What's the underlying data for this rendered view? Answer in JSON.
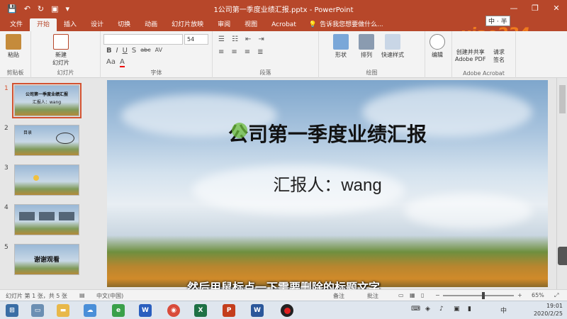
{
  "window": {
    "title": "1公司第一季度业绩汇报.pptx - PowerPoint",
    "controls": [
      "—",
      "❐",
      "✕"
    ]
  },
  "tabs": [
    {
      "label": "文件"
    },
    {
      "label": "开始"
    },
    {
      "label": "插入"
    },
    {
      "label": "设计"
    },
    {
      "label": "切换"
    },
    {
      "label": "动画"
    },
    {
      "label": "幻灯片放映"
    },
    {
      "label": "审阅"
    },
    {
      "label": "视图"
    },
    {
      "label": "Acrobat"
    }
  ],
  "tell_me": "告诉我您想要做什么...",
  "ribbon": {
    "paste": "粘贴",
    "clipboard": "剪贴板",
    "new_slide": "新建\n幻灯片",
    "slides_group": "幻灯片",
    "font_size": "54",
    "font_group": "字体",
    "paragraph_group": "段落",
    "shape": "形状",
    "arrange": "排列",
    "quick_styles": "快速样式",
    "drawing_group": "绘图",
    "edit": "编辑",
    "create_share": "创建并共享\nAdobe PDF",
    "request_sign": "请求\n签名",
    "adobe_group": "Adobe Acrobat",
    "font_buttons": [
      "B",
      "I",
      "U",
      "S",
      "abc",
      "AV",
      "Aa",
      "A"
    ]
  },
  "thumbnails": [
    {
      "num": "1",
      "text": "公司第一季度业绩汇报",
      "sub": "汇报人：wang"
    },
    {
      "num": "2",
      "text": "目录",
      "sub": ""
    },
    {
      "num": "3",
      "text": "",
      "sub": ""
    },
    {
      "num": "4",
      "text": "",
      "sub": ""
    },
    {
      "num": "5",
      "text": "谢谢观看",
      "sub": ""
    }
  ],
  "slide": {
    "title": "公司第一季度业绩汇报",
    "reporter_label": "汇报人：",
    "reporter_name": "wang"
  },
  "caption": "然后用鼠标点一下需要删除的标题文字",
  "status": {
    "slide_info": "幻灯片 第 1 张，共 5 张",
    "language": "中文(中国)",
    "notes": "备注",
    "comments": "批注",
    "zoom": "65%"
  },
  "taskbar": {
    "ime": "中",
    "time": "19:01",
    "date": "2020/2/25"
  },
  "watermark": {
    "brand": "xiao234",
    "ime_badge": "中 · 半"
  }
}
